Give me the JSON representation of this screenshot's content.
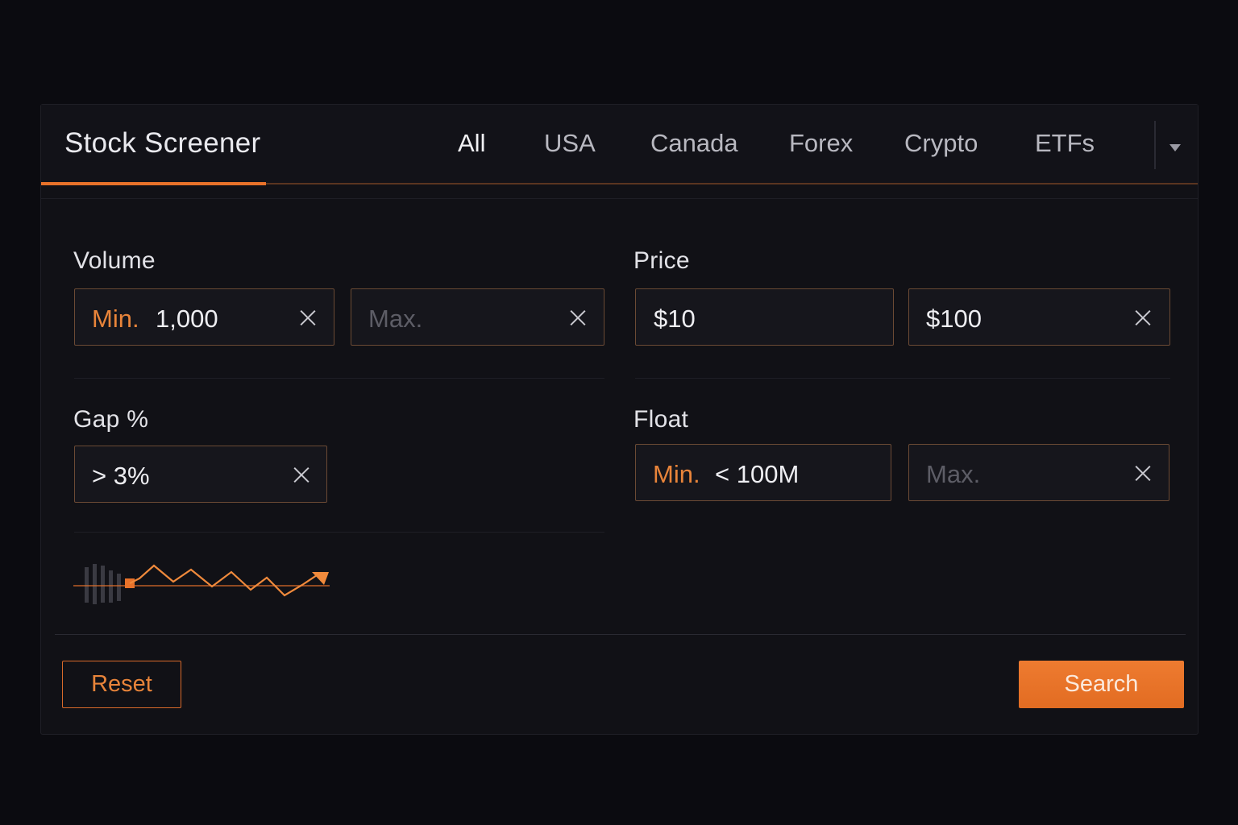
{
  "app": {
    "title": "Stock Screener"
  },
  "tabs": [
    {
      "label": "All",
      "active": true
    },
    {
      "label": "USA"
    },
    {
      "label": "Canada"
    },
    {
      "label": "Forex"
    },
    {
      "label": "Crypto"
    },
    {
      "label": "ETFs"
    }
  ],
  "filters": {
    "volume": {
      "label": "Volume",
      "min": {
        "prefix": "Min.",
        "value": "1,000"
      },
      "max": {
        "placeholder": "Max."
      }
    },
    "price": {
      "label": "Price",
      "min": {
        "value": "$10"
      },
      "max": {
        "value": "$100"
      }
    },
    "gap": {
      "label": "Gap %",
      "value": "> 3%"
    },
    "float": {
      "label": "Float",
      "min": {
        "prefix": "Min.",
        "value": "< 100M"
      },
      "max": {
        "placeholder": "Max."
      }
    }
  },
  "buttons": {
    "reset": "Reset",
    "search": "Search"
  },
  "colors": {
    "accent": "#e8722a",
    "background": "#0b0b10",
    "panel": "#111116"
  },
  "icons": [
    "clear-icon",
    "chevron-down-icon",
    "sparkline-icon"
  ]
}
